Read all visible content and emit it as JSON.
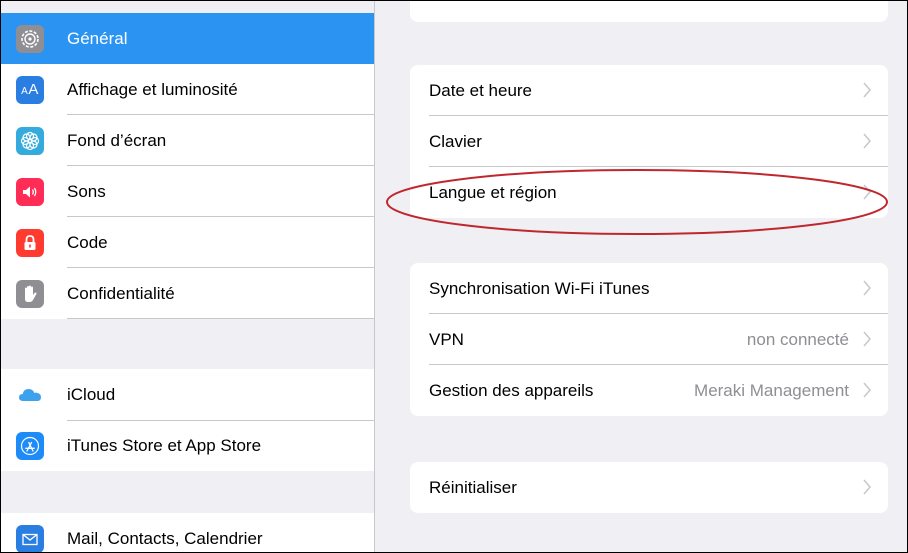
{
  "sidebar": {
    "items": [
      {
        "label": "Général",
        "icon": "gear-icon",
        "color": "#8e8e93",
        "selected": true
      },
      {
        "label": "Affichage et luminosité",
        "icon": "display-brightness-icon",
        "color": "#2a7de1"
      },
      {
        "label": "Fond d’écran",
        "icon": "wallpaper-flower-icon",
        "color": "#35aadc"
      },
      {
        "label": "Sons",
        "icon": "speaker-icon",
        "color": "#ff2d55"
      },
      {
        "label": "Code",
        "icon": "lock-icon",
        "color": "#ff3b30"
      },
      {
        "label": "Confidentialité",
        "icon": "hand-icon",
        "color": "#8e8e93"
      },
      {
        "label": "iCloud",
        "icon": "cloud-icon",
        "color": "#ffffff"
      },
      {
        "label": "iTunes Store et App Store",
        "icon": "app-store-icon",
        "color": "#1d8cf8"
      },
      {
        "label": "Mail, Contacts, Calendrier",
        "icon": "mail-icon",
        "color": "#2a7de1"
      }
    ]
  },
  "detail": {
    "group1": [
      {
        "label": "Date et heure"
      },
      {
        "label": "Clavier"
      },
      {
        "label": "Langue et région"
      }
    ],
    "group2": [
      {
        "label": "Synchronisation Wi-Fi iTunes",
        "value": ""
      },
      {
        "label": "VPN",
        "value": "non connecté"
      },
      {
        "label": "Gestion des appareils",
        "value": "Meraki Management"
      }
    ],
    "group3": [
      {
        "label": "Réinitialiser"
      }
    ]
  },
  "colors": {
    "selection": "#2b94f3",
    "annotation": "#c0272d",
    "background": "#efeff4",
    "separator": "#c8c7cc"
  }
}
